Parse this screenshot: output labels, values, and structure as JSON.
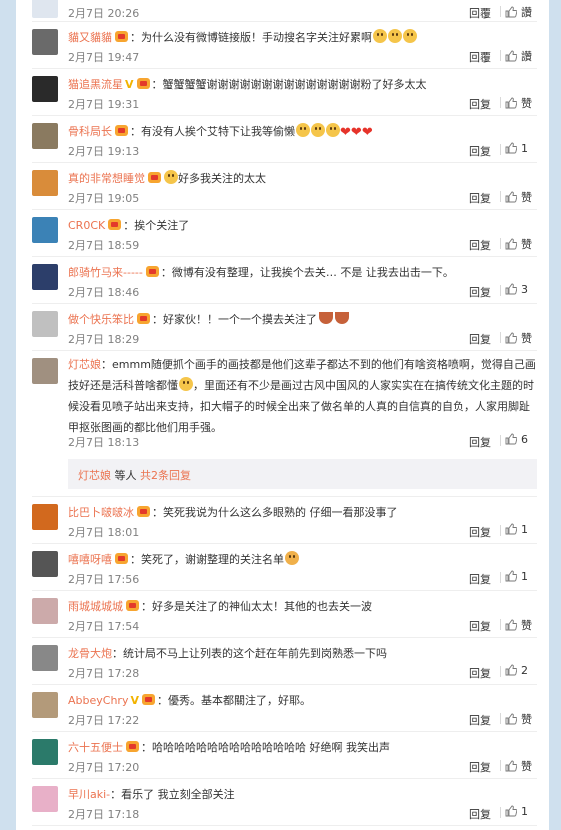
{
  "comments": [
    {
      "user": "",
      "text": "",
      "time": "2月7日 20:26",
      "reply": "回覆",
      "like": "讚",
      "vip": false,
      "partial": true
    },
    {
      "user": "貓又貓貓",
      "text": "：为什么没有微博链接版！手动搜名字关注好累啊",
      "time": "2月7日 19:47",
      "reply": "回覆",
      "like": "讚",
      "vip": true,
      "suffix": "emoji3"
    },
    {
      "user": "猫追黑流星",
      "text": "：蟹蟹蟹蟹谢谢谢谢谢谢谢谢谢谢谢谢谢谢粉了好多太太",
      "time": "2月7日 19:31",
      "reply": "回复",
      "like": "赞",
      "vip": true,
      "vcheck": "V"
    },
    {
      "user": "骨科局长",
      "text": "：有没有人挨个艾特下让我等偷懒",
      "time": "2月7日 19:13",
      "reply": "回复",
      "like": "1",
      "vip": true,
      "suffix": "emoji3hearts3"
    },
    {
      "user": "真的非常想睡觉",
      "text": "好多我关注的太太",
      "time": "2月7日 19:05",
      "reply": "回复",
      "like": "赞",
      "vip": true,
      "prefix": "emoji"
    },
    {
      "user": "CR0CK",
      "text": "：挨个关注了",
      "time": "2月7日 18:59",
      "reply": "回复",
      "like": "赞",
      "vip": true
    },
    {
      "user": "郎骑竹马来-----",
      "text": "：微博有没有整理，让我挨个去关… 不是 让我去出击一下。",
      "time": "2月7日 18:46",
      "reply": "回复",
      "like": "3",
      "vip": true
    },
    {
      "user": "做个快乐笨比",
      "text": "：好家伙！！一个一个摸去关注了",
      "time": "2月7日 18:29",
      "reply": "回复",
      "like": "赞",
      "vip": true,
      "suffix": "bowl2"
    },
    {
      "user": "灯芯娘",
      "text": "：emmm随便抓个画手的画技都是他们这辈子都达不到的他们有啥资格喷啊，觉得自己画技好还是活科普啥都懂",
      "text2": "，里面还有不少是画过古风中国风的人家实实在在搞传统文化主题的时候没看见喷子站出来支持，扣大帽子的时候全出来了做名单的人真的自信真的自负，人家用脚趾甲抠张图画的都比他们用手强。",
      "time": "2月7日 18:13",
      "reply": "回复",
      "like": "6",
      "vip": false,
      "tall": true,
      "sub_user": "灯芯娘",
      "sub_mid": " 等人 ",
      "sub_more": "共2条回复"
    },
    {
      "user": "比巴卜啵啵冰",
      "text": "：笑死我说为什么这么多眼熟的 仔细一看那没事了",
      "time": "2月7日 18:01",
      "reply": "回复",
      "like": "1",
      "vip": true
    },
    {
      "user": "嘻嘻呀嘻",
      "text": "：笑死了，谢谢整理的关注名单",
      "time": "2月7日 17:56",
      "reply": "回复",
      "like": "1",
      "vip": true,
      "suffix": "hands"
    },
    {
      "user": "雨城城城城",
      "text": "：好多是关注了的神仙太太！其他的也去关一波",
      "time": "2月7日 17:54",
      "reply": "回复",
      "like": "赞",
      "vip": true
    },
    {
      "user": "龙骨大炮",
      "text": "：统计局不马上让列表的这个赶在年前先到岗熟悉一下吗",
      "time": "2月7日 17:28",
      "reply": "回复",
      "like": "2",
      "vip": false
    },
    {
      "user": "AbbeyChry",
      "text": "：優秀。基本都關注了，好耶。",
      "time": "2月7日 17:22",
      "reply": "回复",
      "like": "赞",
      "vip": true,
      "vcheck": "V"
    },
    {
      "user": "六十五便士",
      "text": "：哈哈哈哈哈哈哈哈哈哈哈哈哈哈 好绝啊 我笑出声",
      "time": "2月7日 17:20",
      "reply": "回复",
      "like": "赞",
      "vip": true
    },
    {
      "user": "早川aki-",
      "text": "：看乐了 我立刻全部关注",
      "time": "2月7日 17:18",
      "reply": "回复",
      "like": "1",
      "vip": false
    }
  ]
}
